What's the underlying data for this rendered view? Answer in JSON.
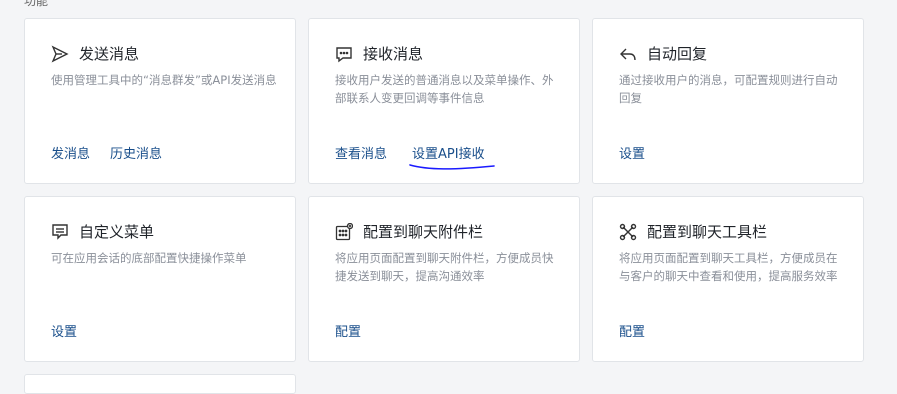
{
  "section": {
    "label": "功能"
  },
  "cards": [
    {
      "title": "发送消息",
      "icon": "send-icon",
      "desc": "使用管理工具中的“消息群发”或API发送消息",
      "links": [
        "发消息",
        "历史消息"
      ]
    },
    {
      "title": "接收消息",
      "icon": "chat-bubble-icon",
      "desc": "接收用户发送的普通消息以及菜单操作、外部联系人变更回调等事件信息",
      "links": [
        "查看消息",
        "设置API接收"
      ]
    },
    {
      "title": "自动回复",
      "icon": "reply-icon",
      "desc": "通过接收用户的消息，可配置规则进行自动回复",
      "links": [
        "设置"
      ]
    },
    {
      "title": "自定义菜单",
      "icon": "menu-icon",
      "desc": "可在应用会话的底部配置快捷操作菜单",
      "links": [
        "设置"
      ]
    },
    {
      "title": "配置到聊天附件栏",
      "icon": "attachment-grid-icon",
      "desc": "将应用页面配置到聊天附件栏，方便成员快捷发送到聊天，提高沟通效率",
      "links": [
        "配置"
      ]
    },
    {
      "title": "配置到聊天工具栏",
      "icon": "toolbar-icon",
      "desc": "将应用页面配置到聊天工具栏，方便成员在与客户的聊天中查看和使用，提高服务效率",
      "links": [
        "配置"
      ]
    }
  ],
  "colors": {
    "link": "#1a4f8b",
    "annotation": "#1a1aff"
  }
}
